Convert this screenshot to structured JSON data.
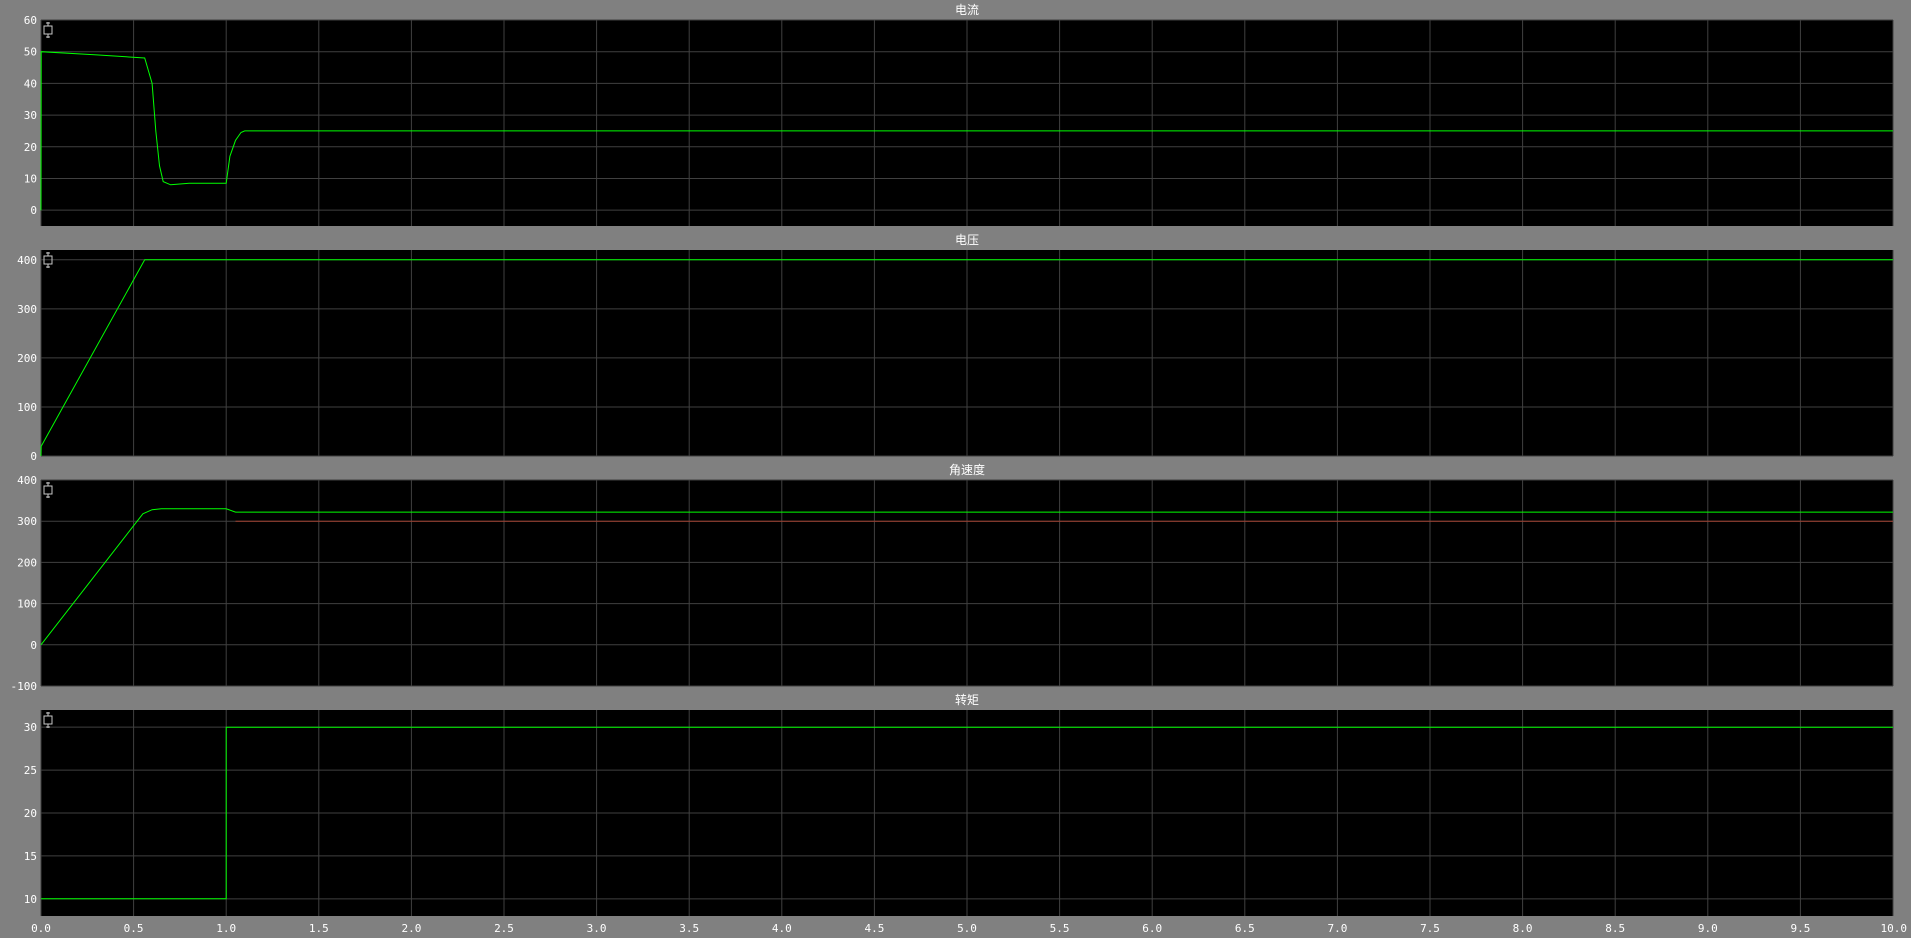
{
  "colors": {
    "background": "#808080",
    "plot_bg": "#000000",
    "grid": "#404040",
    "signal": "#00ff00",
    "reference": "#a04030",
    "text": "#ffffff"
  },
  "x_ticks": [
    "0.0",
    "0.5",
    "1.0",
    "1.5",
    "2.0",
    "2.5",
    "3.0",
    "3.5",
    "4.0",
    "4.5",
    "5.0",
    "5.5",
    "6.0",
    "6.5",
    "7.0",
    "7.5",
    "8.0",
    "8.5",
    "9.0",
    "9.5",
    "10.0"
  ],
  "chart_data": [
    {
      "type": "line",
      "title": "电流",
      "xlim": [
        0,
        10
      ],
      "ylim": [
        -5,
        60
      ],
      "y_ticks": [
        "0",
        "10",
        "20",
        "30",
        "40",
        "50",
        "60"
      ],
      "grid": true,
      "series": [
        {
          "x": [
            0,
            0.001,
            0.3,
            0.56,
            0.6,
            0.62,
            0.64,
            0.66,
            0.7,
            0.8,
            0.9,
            1.0,
            1.02,
            1.05,
            1.08,
            1.1,
            10
          ],
          "y": [
            0,
            50,
            49,
            48,
            40,
            25,
            14,
            9,
            8,
            8.5,
            8.5,
            8.5,
            17,
            22,
            24.5,
            25,
            25
          ]
        }
      ]
    },
    {
      "type": "line",
      "title": "电压",
      "xlim": [
        0,
        10
      ],
      "ylim": [
        0,
        420
      ],
      "y_ticks": [
        "0",
        "100",
        "200",
        "300",
        "400"
      ],
      "grid": true,
      "series": [
        {
          "x": [
            0,
            0.001,
            0.56,
            10
          ],
          "y": [
            0,
            20,
            400,
            400
          ]
        }
      ]
    },
    {
      "type": "line",
      "title": "角速度",
      "xlim": [
        0,
        10
      ],
      "ylim": [
        -100,
        400
      ],
      "y_ticks": [
        "-100",
        "0",
        "100",
        "200",
        "300",
        "400"
      ],
      "grid": true,
      "series": [
        {
          "x": [
            0,
            0.55,
            0.6,
            0.65,
            1.0,
            1.05,
            10
          ],
          "y": [
            0,
            318,
            328,
            330,
            330,
            322,
            322
          ]
        },
        {
          "x": [
            1.05,
            10
          ],
          "y": [
            300,
            300
          ],
          "style": "reference"
        }
      ]
    },
    {
      "type": "line",
      "title": "转矩",
      "xlim": [
        0,
        10
      ],
      "ylim": [
        8,
        32
      ],
      "y_ticks": [
        "10",
        "15",
        "20",
        "25",
        "30"
      ],
      "grid": true,
      "series": [
        {
          "x": [
            0,
            1.0,
            1.0,
            10
          ],
          "y": [
            10,
            10,
            30,
            30
          ]
        }
      ]
    }
  ]
}
